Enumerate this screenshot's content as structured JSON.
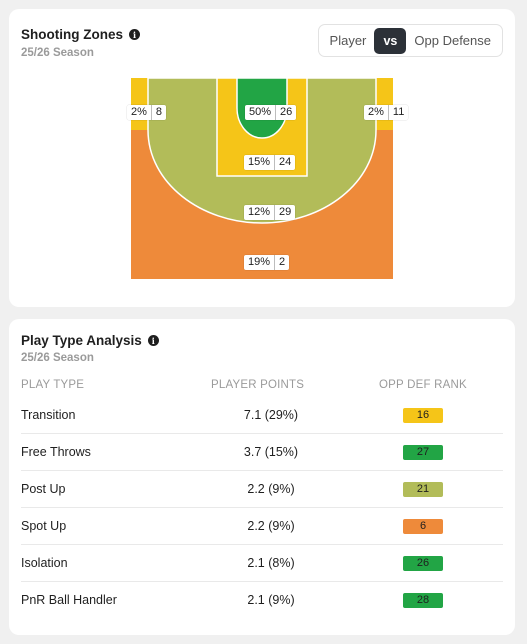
{
  "shooting": {
    "title": "Shooting Zones",
    "season": "25/26 Season",
    "toggle": {
      "left": "Player",
      "vs": "vs",
      "right": "Opp Defense"
    },
    "zones": [
      {
        "id": "left-corner",
        "pct": "2%",
        "value": "8",
        "color": "#f5c518"
      },
      {
        "id": "restricted-area",
        "pct": "50%",
        "value": "26",
        "color": "#22a545"
      },
      {
        "id": "right-corner",
        "pct": "2%",
        "value": "11",
        "color": "#f5c518"
      },
      {
        "id": "paint",
        "pct": "15%",
        "value": "24",
        "color": "#f5c518"
      },
      {
        "id": "midrange",
        "pct": "12%",
        "value": "29",
        "color": "#b2bc59"
      },
      {
        "id": "above-break-three",
        "pct": "19%",
        "value": "2",
        "color": "#ee8a3a"
      }
    ]
  },
  "plays": {
    "title": "Play Type Analysis",
    "season": "25/26 Season",
    "headers": {
      "play_type": "PLAY TYPE",
      "player_points": "PLAYER POINTS",
      "opp_def_rank": "OPP DEF RANK"
    },
    "rows": [
      {
        "play_type": "Transition",
        "points": "7.1 (29%)",
        "rank": "16",
        "rank_color": "#f5c518"
      },
      {
        "play_type": "Free Throws",
        "points": "3.7 (15%)",
        "rank": "27",
        "rank_color": "#22a545"
      },
      {
        "play_type": "Post Up",
        "points": "2.2 (9%)",
        "rank": "21",
        "rank_color": "#b2bc59"
      },
      {
        "play_type": "Spot Up",
        "points": "2.2 (9%)",
        "rank": "6",
        "rank_color": "#ee8a3a"
      },
      {
        "play_type": "Isolation",
        "points": "2.1 (8%)",
        "rank": "26",
        "rank_color": "#22a545"
      },
      {
        "play_type": "PnR Ball Handler",
        "points": "2.1 (9%)",
        "rank": "28",
        "rank_color": "#22a545"
      }
    ]
  }
}
